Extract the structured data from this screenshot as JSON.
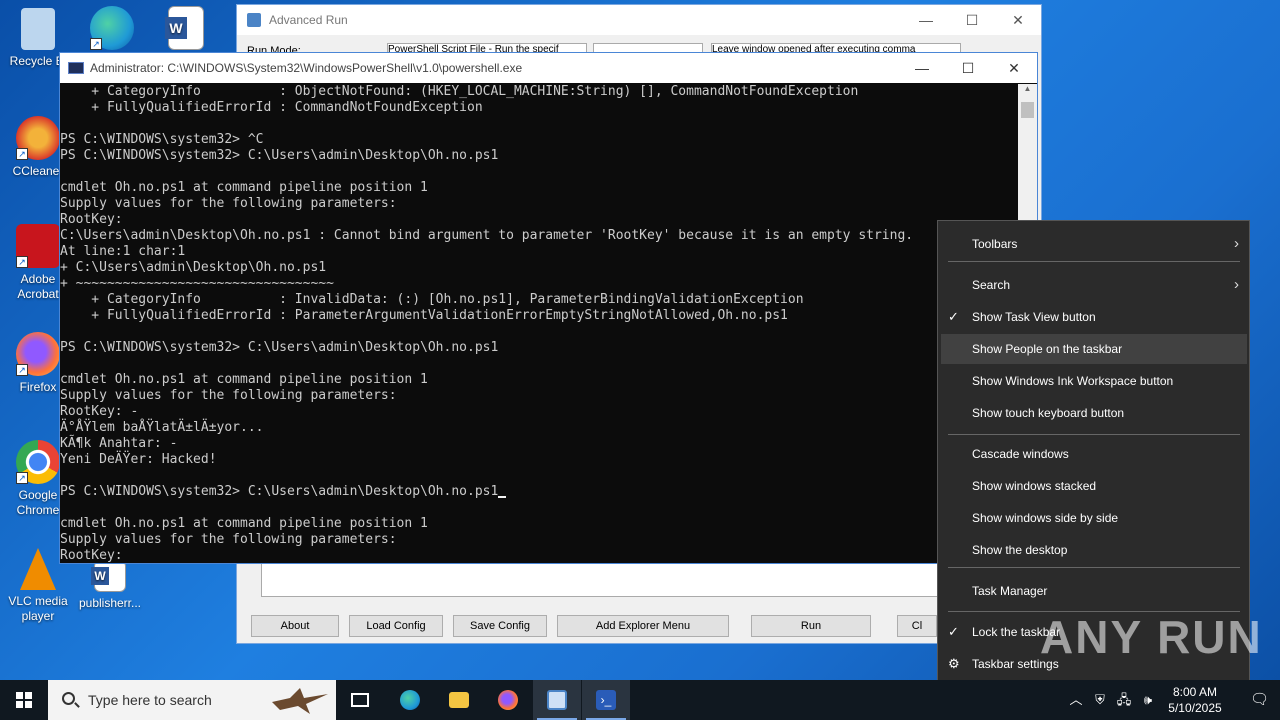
{
  "desktop": {
    "icons": [
      {
        "label": "Recycle Bi",
        "icon": "recycle-bin-icon",
        "color": "#9fc6e8"
      },
      {
        "label": "CCleaner",
        "icon": "ccleaner-icon",
        "color": "#d9382a"
      },
      {
        "label": "Adobe Acrobat",
        "icon": "acrobat-icon",
        "color": "#c8151d"
      },
      {
        "label": "Firefox",
        "icon": "firefox-icon",
        "color": "#ff7139"
      },
      {
        "label": "Google Chrome",
        "icon": "chrome-icon",
        "color": "#34a853"
      },
      {
        "label": "VLC media player",
        "icon": "vlc-icon",
        "color": "#f08c00"
      }
    ],
    "extra_icons": [
      {
        "label": "",
        "icon": "edge-icon",
        "color": "#1f9ad6"
      },
      {
        "label": "",
        "icon": "word-icon",
        "color": "#2b579a"
      },
      {
        "label": "publisherr...",
        "icon": "word-doc-icon",
        "color": "#2b579a"
      }
    ]
  },
  "advanced_run": {
    "title": "Advanced Run",
    "run_mode_label": "Run Mode:",
    "run_mode_value": "PowerShell Script File - Run the specif",
    "window_mode_value": "Leave window opened after executing comma",
    "buttons": [
      "About",
      "Load Config",
      "Save Config",
      "Add Explorer Menu",
      "Run",
      "Cl"
    ]
  },
  "powershell": {
    "title": "Administrator: C:\\WINDOWS\\System32\\WindowsPowerShell\\v1.0\\powershell.exe",
    "lines": [
      {
        "t": "    + CategoryInfo          : ObjectNotFound: (HKEY_LOCAL_MACHINE:String) [], CommandNotFoundException",
        "c": "err"
      },
      {
        "t": "    + FullyQualifiedErrorId : CommandNotFoundException",
        "c": "err"
      },
      {
        "t": "",
        "c": ""
      },
      {
        "t": "PS C:\\WINDOWS\\system32> ^C",
        "c": ""
      },
      {
        "t": "PS C:\\WINDOWS\\system32> C:\\Users\\admin\\Desktop\\Oh.no.ps1",
        "c": "white"
      },
      {
        "t": "",
        "c": ""
      },
      {
        "t": "cmdlet Oh.no.ps1 at command pipeline position 1",
        "c": "white"
      },
      {
        "t": "Supply values for the following parameters:",
        "c": "white"
      },
      {
        "t": "RootKey:",
        "c": "white"
      },
      {
        "t": "C:\\Users\\admin\\Desktop\\Oh.no.ps1 : Cannot bind argument to parameter 'RootKey' because it is an empty string.",
        "c": "err"
      },
      {
        "t": "At line:1 char:1",
        "c": "err"
      },
      {
        "t": "+ C:\\Users\\admin\\Desktop\\Oh.no.ps1",
        "c": "err"
      },
      {
        "t": "+ ~~~~~~~~~~~~~~~~~~~~~~~~~~~~~~~~~",
        "c": "err"
      },
      {
        "t": "    + CategoryInfo          : InvalidData: (:) [Oh.no.ps1], ParameterBindingValidationException",
        "c": "err"
      },
      {
        "t": "    + FullyQualifiedErrorId : ParameterArgumentValidationErrorEmptyStringNotAllowed,Oh.no.ps1",
        "c": "err"
      },
      {
        "t": "",
        "c": ""
      },
      {
        "t": "PS C:\\WINDOWS\\system32> C:\\Users\\admin\\Desktop\\Oh.no.ps1",
        "c": "white"
      },
      {
        "t": "",
        "c": ""
      },
      {
        "t": "cmdlet Oh.no.ps1 at command pipeline position 1",
        "c": "white"
      },
      {
        "t": "Supply values for the following parameters:",
        "c": "white"
      },
      {
        "t": "RootKey: -",
        "c": "white"
      },
      {
        "t": "Ä°ÅŸlem baÅŸlatÄ±lÄ±yor...",
        "c": "white"
      },
      {
        "t": "KÃ¶k Anahtar: -",
        "c": "white"
      },
      {
        "t": "Yeni DeÄŸer: Hacked!",
        "c": "white"
      },
      {
        "t": "",
        "c": ""
      },
      {
        "t": "PS C:\\WINDOWS\\system32> C:\\Users\\admin\\Desktop\\Oh.no.ps1",
        "c": "white",
        "cursor": true
      },
      {
        "t": "",
        "c": ""
      },
      {
        "t": "cmdlet Oh.no.ps1 at command pipeline position 1",
        "c": "white"
      },
      {
        "t": "Supply values for the following parameters:",
        "c": "white"
      },
      {
        "t": "RootKey:",
        "c": "white"
      }
    ]
  },
  "context_menu": {
    "items": [
      {
        "label": "Toolbars",
        "submenu": true
      },
      {
        "label": "Search",
        "submenu": true
      },
      {
        "label": "Show Task View button",
        "checked": true
      },
      {
        "label": "Show People on the taskbar",
        "highlighted": true
      },
      {
        "label": "Show Windows Ink Workspace button"
      },
      {
        "label": "Show touch keyboard button"
      },
      {
        "label": "Cascade windows"
      },
      {
        "label": "Show windows stacked"
      },
      {
        "label": "Show windows side by side"
      },
      {
        "label": "Show the desktop"
      },
      {
        "label": "Task Manager"
      },
      {
        "label": "Lock the taskbar",
        "checked": true
      },
      {
        "label": "Taskbar settings",
        "gear": true
      }
    ]
  },
  "taskbar": {
    "search_placeholder": "Type here to search",
    "time": "8:00 AM",
    "date": "5/10/2025",
    "apps": [
      "task-view-icon",
      "edge-icon",
      "file-explorer-icon",
      "firefox-icon",
      "advanced-run-icon",
      "powershell-icon"
    ]
  },
  "watermark": "ANY RUN",
  "colors": {
    "console_bg": "#0c0c0c",
    "error_text": "#e74856",
    "menu_bg": "#2b2b2b",
    "taskbar_bg": "#101820"
  }
}
